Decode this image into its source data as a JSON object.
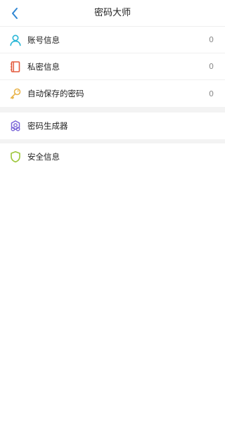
{
  "header": {
    "title": "密码大师",
    "back_icon": "chevron-left-icon"
  },
  "groups": [
    {
      "items": [
        {
          "label": "账号信息",
          "count": "0",
          "icon": "person-icon",
          "icon_color": "#27b6d6"
        },
        {
          "label": "私密信息",
          "count": "0",
          "icon": "notebook-icon",
          "icon_color": "#e35a3d"
        },
        {
          "label": "自动保存的密码",
          "count": "0",
          "icon": "key-icon",
          "icon_color": "#e9b44b"
        }
      ]
    },
    {
      "items": [
        {
          "label": "密码生成器",
          "icon": "generator-icon",
          "icon_color": "#7a66d8"
        }
      ]
    },
    {
      "items": [
        {
          "label": "安全信息",
          "icon": "shield-icon",
          "icon_color": "#9dc63a"
        }
      ]
    }
  ],
  "colors": {
    "accent": "#2f86d3",
    "divider": "#f0f0f0",
    "section_gap": "#f3f3f3"
  }
}
